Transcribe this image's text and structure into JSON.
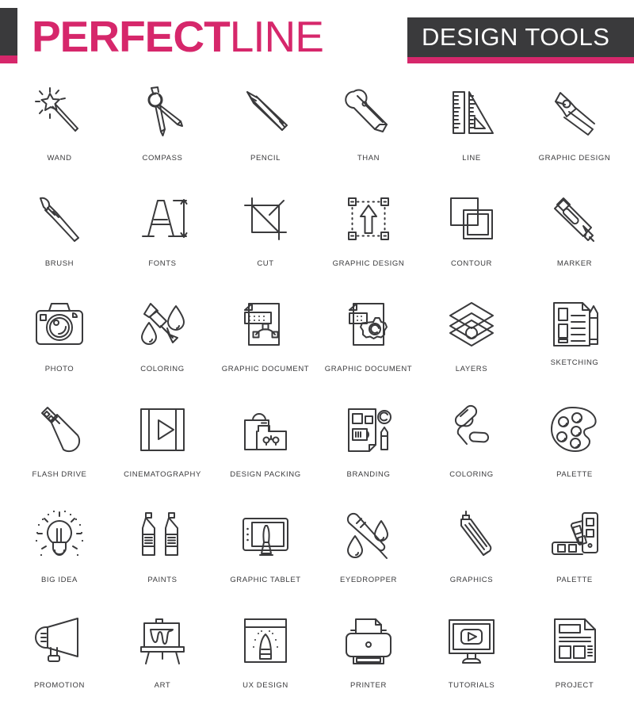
{
  "header": {
    "brand_strong": "PERFECT",
    "brand_light": "LINE",
    "badge": "DESIGN TOOLS",
    "accent_color": "#d6276b",
    "dark_color": "#3a3a3c"
  },
  "icons": [
    {
      "label": "WAND",
      "icon": "magic-wand-icon"
    },
    {
      "label": "COMPASS",
      "icon": "compass-divider-icon"
    },
    {
      "label": "PENCIL",
      "icon": "pencil-icon"
    },
    {
      "label": "THAN",
      "icon": "utility-knife-icon"
    },
    {
      "label": "LINE",
      "icon": "ruler-triangle-icon"
    },
    {
      "label": "GRAPHIC DESIGN",
      "icon": "calligraphy-nib-icon"
    },
    {
      "label": "BRUSH",
      "icon": "paint-brush-icon"
    },
    {
      "label": "FONTS",
      "icon": "letter-a-measure-icon"
    },
    {
      "label": "CUT",
      "icon": "crop-tool-icon"
    },
    {
      "label": "GRAPHIC DESIGN",
      "icon": "selection-arrow-icon"
    },
    {
      "label": "CONTOUR",
      "icon": "overlapping-squares-icon"
    },
    {
      "label": "MARKER",
      "icon": "marker-pen-icon"
    },
    {
      "label": "PHOTO",
      "icon": "camera-icon"
    },
    {
      "label": "COLORING",
      "icon": "brush-droplets-icon"
    },
    {
      "label": "GRAPHIC DOCUMENT",
      "icon": "document-bezier-curve-icon"
    },
    {
      "label": "GRAPHIC DOCUMENT",
      "icon": "document-gear-icon"
    },
    {
      "label": "LAYERS",
      "icon": "layers-icon"
    },
    {
      "label": "SKETCHING",
      "icon": "document-pencil-icon"
    },
    {
      "label": "FLASH DRIVE",
      "icon": "usb-flash-drive-icon"
    },
    {
      "label": "CINEMATOGRAPHY",
      "icon": "film-play-icon"
    },
    {
      "label": "DESIGN PACKING",
      "icon": "shopping-bag-box-icon"
    },
    {
      "label": "BRANDING",
      "icon": "branding-sheet-icon"
    },
    {
      "label": "COLORING",
      "icon": "paint-roller-icon"
    },
    {
      "label": "PALETTE",
      "icon": "paint-palette-icon"
    },
    {
      "label": "BIG IDEA",
      "icon": "lightbulb-idea-icon"
    },
    {
      "label": "PAINTS",
      "icon": "paint-tubes-icon"
    },
    {
      "label": "GRAPHIC TABLET",
      "icon": "graphic-tablet-icon"
    },
    {
      "label": "EYEDROPPER",
      "icon": "eyedropper-droplets-icon"
    },
    {
      "label": "GRAPHICS",
      "icon": "technical-pen-icon"
    },
    {
      "label": "PALETTE",
      "icon": "color-swatch-fan-icon"
    },
    {
      "label": "PROMOTION",
      "icon": "megaphone-icon"
    },
    {
      "label": "ART",
      "icon": "easel-canvas-icon"
    },
    {
      "label": "UX DESIGN",
      "icon": "ux-screen-icon"
    },
    {
      "label": "PRINTER",
      "icon": "printer-icon"
    },
    {
      "label": "TUTORIALS",
      "icon": "monitor-play-icon"
    },
    {
      "label": "PROJECT",
      "icon": "newspaper-layout-icon"
    }
  ]
}
